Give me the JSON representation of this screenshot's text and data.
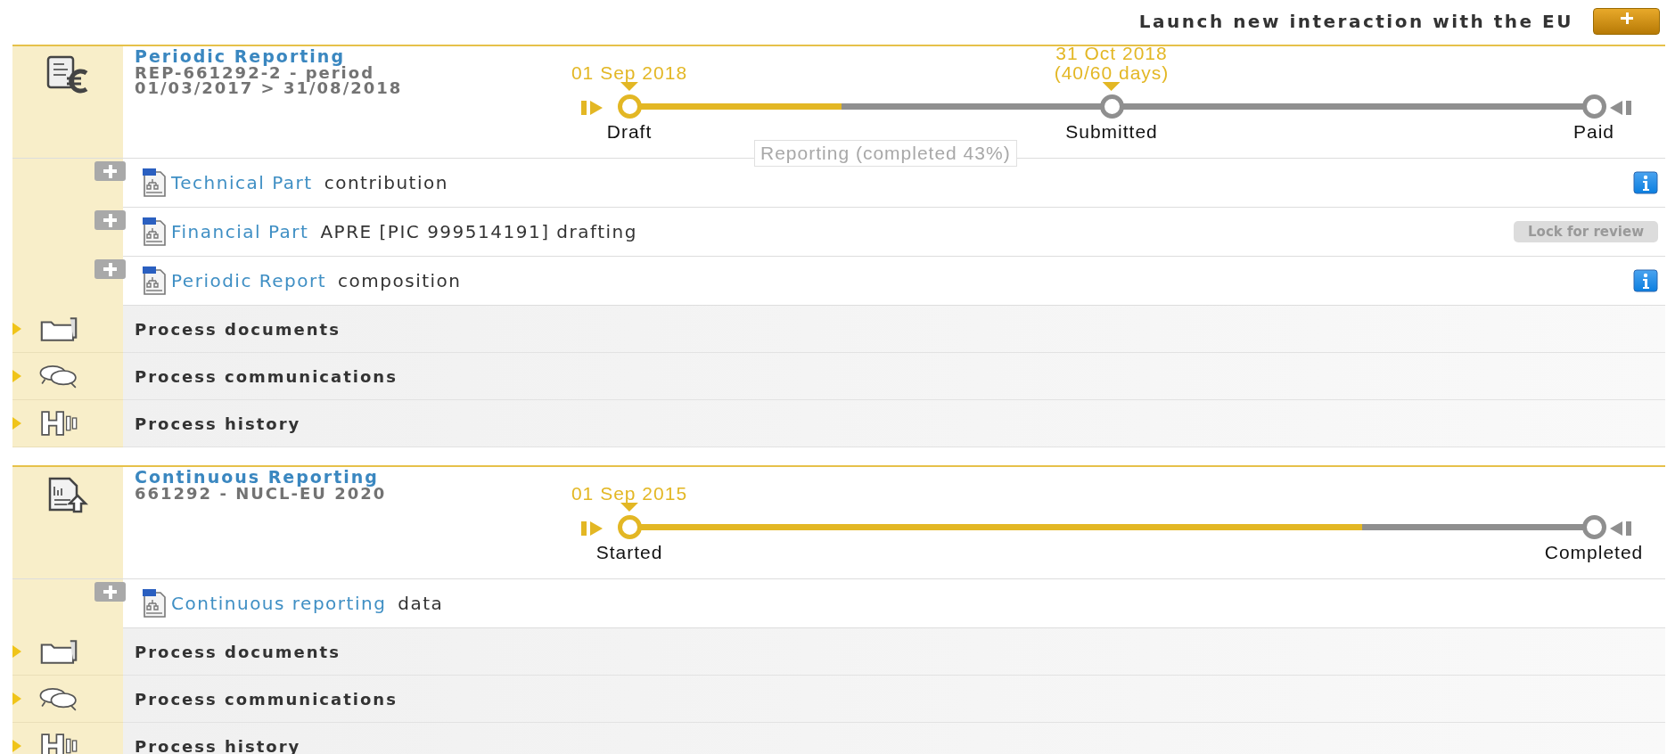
{
  "launch": {
    "label": "Launch new interaction with the EU"
  },
  "processes": [
    {
      "kind": "periodic",
      "title": "Periodic Reporting",
      "subtitle": [
        "REP-661292-2 - period",
        "01/03/2017 > 31/08/2018"
      ],
      "timeline": {
        "level": 0.22,
        "milestones": [
          {
            "label": "Draft",
            "date": [
              "01 Sep 2018"
            ],
            "reached": true
          },
          {
            "label": "Submitted",
            "date": [
              "31 Oct 2018",
              "(40/60 days)"
            ],
            "reached": false
          },
          {
            "label": "Paid",
            "reached": false
          }
        ]
      },
      "tooltip": "Reporting (completed 43%)",
      "items": [
        {
          "name": "Technical Part",
          "status": "contribution",
          "expanded": false,
          "action": {
            "kind": "info"
          }
        },
        {
          "name": "Financial Part",
          "status": "APRE [PIC 999514191] drafting",
          "expanded": false,
          "action": {
            "kind": "button",
            "label": "Lock for review",
            "disabled": true
          }
        },
        {
          "name": "Periodic Report",
          "status": "composition",
          "expanded": false,
          "action": {
            "kind": "info"
          }
        }
      ],
      "sections": [
        {
          "kind": "documents",
          "label": "Process documents",
          "expanded": false
        },
        {
          "kind": "communications",
          "label": "Process communications",
          "expanded": false
        },
        {
          "kind": "history",
          "label": "Process history",
          "expanded": false
        }
      ]
    },
    {
      "kind": "continuous",
      "title": "Continuous Reporting",
      "subtitle": [
        "661292 - NUCL-EU 2020"
      ],
      "timeline": {
        "level": 0.76,
        "milestones": [
          {
            "label": "Started",
            "date": [
              "01 Sep 2015"
            ],
            "reached": true
          },
          {
            "label": "Completed",
            "reached": false
          }
        ]
      },
      "items": [
        {
          "name": "Continuous reporting",
          "status": "data",
          "expanded": false
        }
      ],
      "sections": [
        {
          "kind": "documents",
          "label": "Process documents",
          "expanded": false
        },
        {
          "kind": "communications",
          "label": "Process communications",
          "expanded": false
        },
        {
          "kind": "history",
          "label": "Process history",
          "expanded": false
        }
      ]
    }
  ]
}
